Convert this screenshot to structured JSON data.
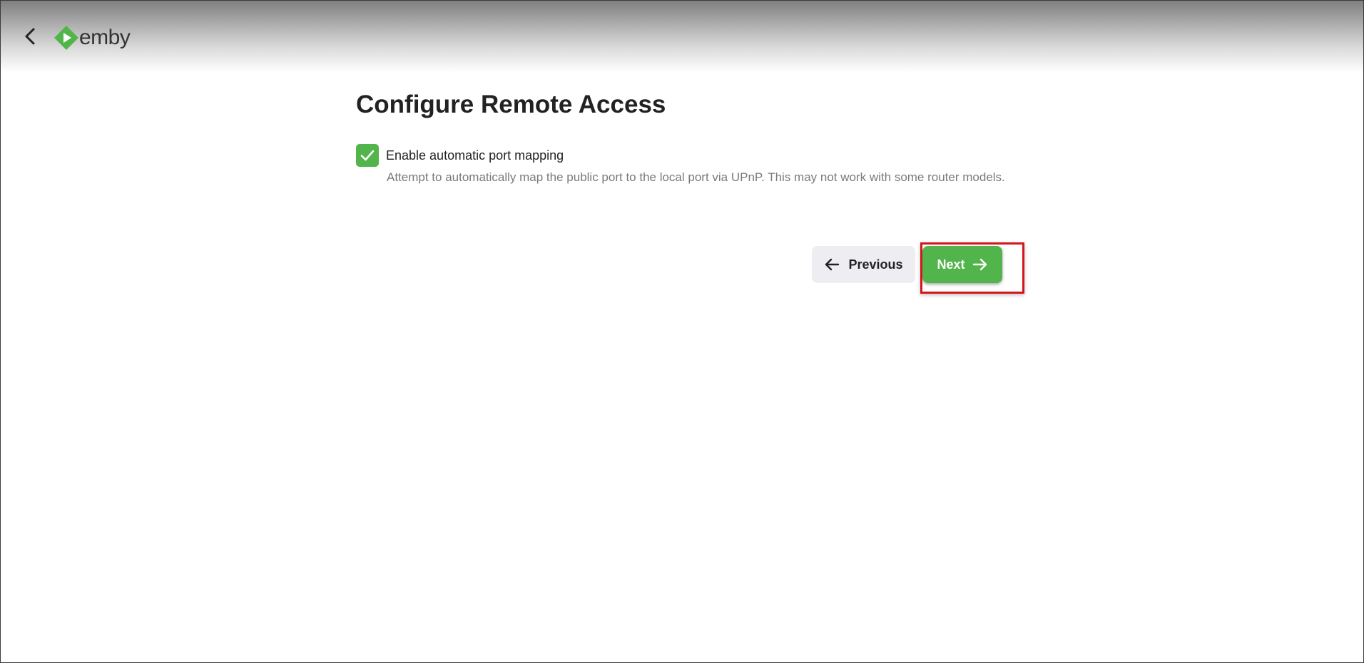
{
  "app": {
    "logo_text": "emby",
    "brand_color": "#52b54b"
  },
  "header": {
    "back_icon": "chevron-left-icon",
    "logo_icon": "emby-play-diamond-icon"
  },
  "page": {
    "title": "Configure Remote Access"
  },
  "settings": {
    "port_mapping": {
      "checked": true,
      "label": "Enable automatic port mapping",
      "description": "Attempt to automatically map the public port to the local port via UPnP. This may not work with some router models."
    }
  },
  "actions": {
    "previous_label": "Previous",
    "previous_icon": "arrow-left-icon",
    "next_label": "Next",
    "next_icon": "arrow-right-icon",
    "highlight_color": "#d4161c"
  }
}
